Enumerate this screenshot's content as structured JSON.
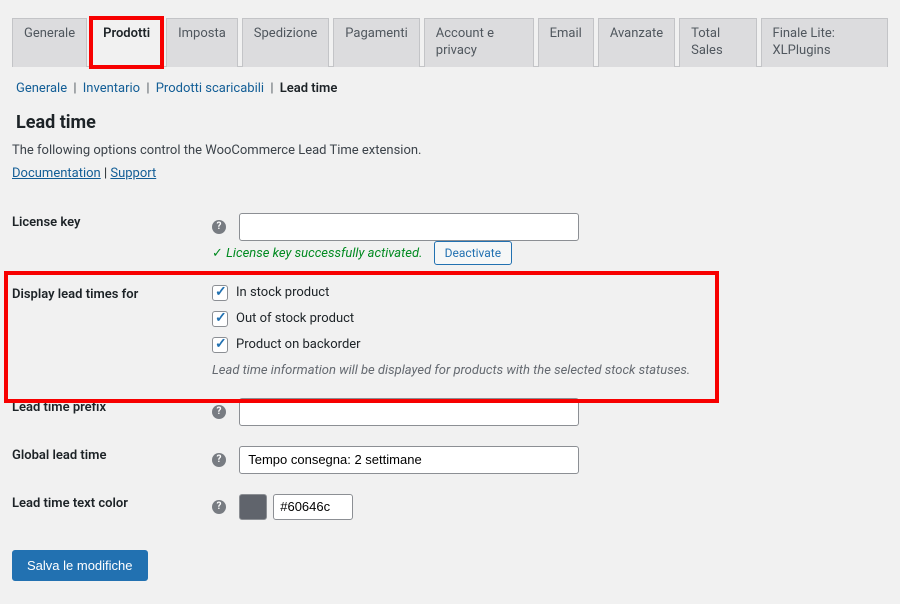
{
  "tabs": {
    "generale": "Generale",
    "prodotti": "Prodotti",
    "imposta": "Imposta",
    "spedizione": "Spedizione",
    "pagamenti": "Pagamenti",
    "account": "Account e privacy",
    "email": "Email",
    "avanzate": "Avanzate",
    "totalsales": "Total Sales",
    "finale": "Finale Lite: XLPlugins"
  },
  "subnav": {
    "generale": "Generale",
    "inventario": "Inventario",
    "scaricabili": "Prodotti scaricabili",
    "leadtime": "Lead time"
  },
  "section_title": "Lead time",
  "section_desc": "The following options control the WooCommerce Lead Time extension.",
  "links": {
    "documentation": "Documentation",
    "support": "Support"
  },
  "fields": {
    "license_key": {
      "label": "License key",
      "value": ""
    },
    "license_msg": "License key successfully activated.",
    "deactivate_btn": "Deactivate",
    "display_label": "Display lead times for",
    "opt_instock": "In stock product",
    "opt_outstock": "Out of stock product",
    "opt_backorder": "Product on backorder",
    "display_help": "Lead time information will be displayed for products with the selected stock statuses.",
    "prefix": {
      "label": "Lead time prefix",
      "value": ""
    },
    "global": {
      "label": "Global lead time",
      "value": "Tempo consegna: 2 settimane"
    },
    "color": {
      "label": "Lead time text color",
      "value": "#60646c"
    }
  },
  "save_btn": "Salva le modifiche"
}
